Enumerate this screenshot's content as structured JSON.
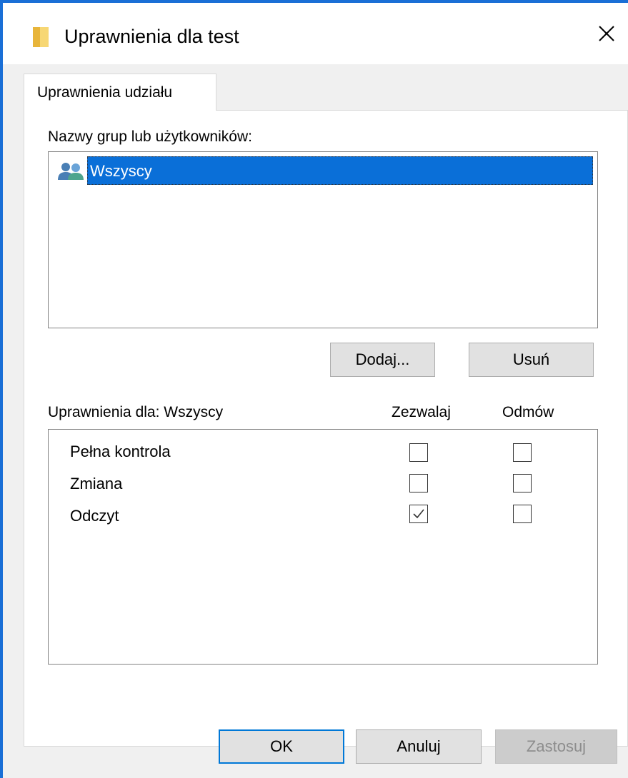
{
  "window": {
    "title": "Uprawnienia dla test",
    "accent_color": "#1a6fd6",
    "icons": {
      "title": "folder-icon",
      "close": "close-icon"
    }
  },
  "tabs": [
    {
      "label": "Uprawnienia udziału",
      "active": true
    }
  ],
  "groups": {
    "label": "Nazwy grup lub użytkowników:",
    "items": [
      {
        "name": "Wszyscy",
        "icon": "group-users-icon",
        "selected": true
      }
    ],
    "add_label": "Dodaj...",
    "remove_label": "Usuń"
  },
  "permissions": {
    "label": "Uprawnienia dla: Wszyscy",
    "allow_header": "Zezwalaj",
    "deny_header": "Odmów",
    "rows": [
      {
        "name": "Pełna kontrola",
        "allow": false,
        "deny": false
      },
      {
        "name": "Zmiana",
        "allow": false,
        "deny": false
      },
      {
        "name": "Odczyt",
        "allow": true,
        "deny": false
      }
    ]
  },
  "footer": {
    "ok_label": "OK",
    "cancel_label": "Anuluj",
    "apply_label": "Zastosuj",
    "apply_enabled": false
  }
}
